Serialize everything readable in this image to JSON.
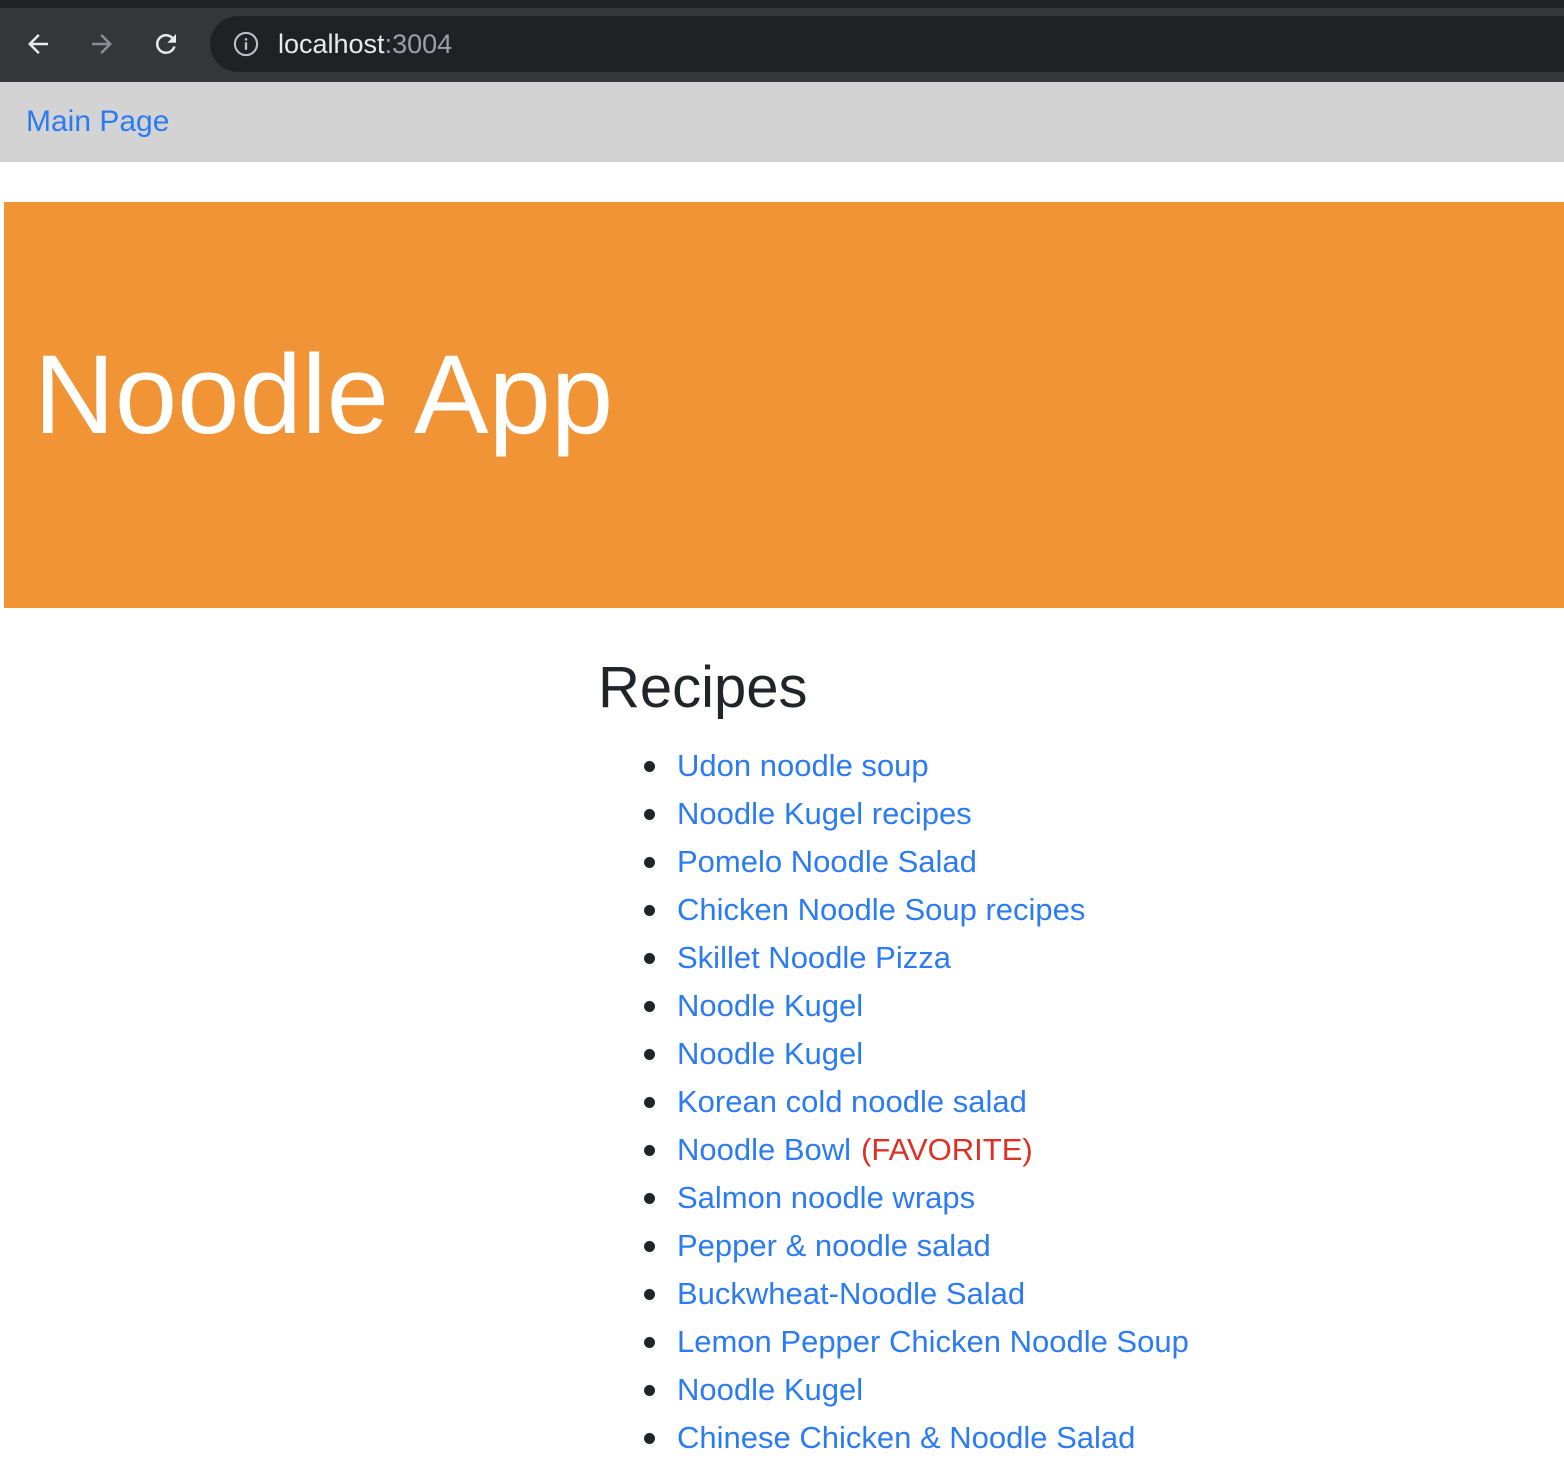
{
  "browser": {
    "url_host": "localhost",
    "url_port": ":3004",
    "icons": {
      "back": "arrow-left-icon",
      "forward": "arrow-right-icon",
      "reload": "reload-icon",
      "info": "info-circle-icon"
    }
  },
  "navbar": {
    "main_link": "Main Page",
    "link_color": "#2b7bf3",
    "background": "#d3d3d3"
  },
  "hero": {
    "title": "Noodle App",
    "background": "#f09436"
  },
  "recipes": {
    "heading": "Recipes",
    "favorite_label": "(FAVORITE)",
    "favorite_color": "#dc3124",
    "items": [
      {
        "name": "Udon noodle soup",
        "favorite": false
      },
      {
        "name": "Noodle Kugel recipes",
        "favorite": false
      },
      {
        "name": "Pomelo Noodle Salad",
        "favorite": false
      },
      {
        "name": "Chicken Noodle Soup recipes",
        "favorite": false
      },
      {
        "name": "Skillet Noodle Pizza",
        "favorite": false
      },
      {
        "name": "Noodle Kugel",
        "favorite": false
      },
      {
        "name": "Noodle Kugel",
        "favorite": false
      },
      {
        "name": "Korean cold noodle salad",
        "favorite": false
      },
      {
        "name": "Noodle Bowl",
        "favorite": true
      },
      {
        "name": "Salmon noodle wraps",
        "favorite": false
      },
      {
        "name": "Pepper & noodle salad",
        "favorite": false
      },
      {
        "name": "Buckwheat-Noodle Salad",
        "favorite": false
      },
      {
        "name": "Lemon Pepper Chicken Noodle Soup",
        "favorite": false
      },
      {
        "name": "Noodle Kugel",
        "favorite": false
      },
      {
        "name": "Chinese Chicken & Noodle Salad",
        "favorite": false
      }
    ]
  }
}
